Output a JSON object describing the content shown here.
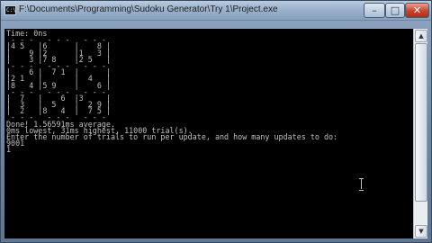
{
  "window": {
    "title": "F:\\Documents\\Programming\\Sudoku Generator\\Try 1\\Project.exe",
    "app_icon_text": "C:\\",
    "app_icon": "console-window-icon"
  },
  "caption_buttons": {
    "minimize": "–",
    "maximize": "□",
    "close": "✕"
  },
  "scrollbar": {
    "up": "▲",
    "down": "▼"
  },
  "console": {
    "lines": [
      "Time: 0ns",
      " - - -   - - -   - - -",
      "|4 5   |6      |    8 |",
      "|    9 |2      |1   3 |",
      "|    3 |7 8    |2 5   |",
      " - - -   - - -   - - -",
      "|    6 |  7 1  |      |",
      "|2 1   |       |  4   |",
      "|8   4 |5 9    |    6 |",
      " - - -   - - -   - - -",
      "|  7   |    6  |3     |",
      "|  3   |  5    |  2 9 |",
      "|  2   |8   4  |  7 5 |",
      " - - -   - - -   - - -",
      "Done! 1.56591ms average.",
      "0ms lowest, 31ms highest, 11000 trial(s).",
      "Enter the number of trials to run per update, and how many updates to do:",
      "9001",
      "1"
    ]
  }
}
